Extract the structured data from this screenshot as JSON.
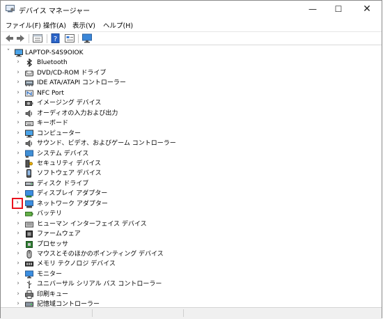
{
  "window": {
    "title": "デバイス マネージャー"
  },
  "menu": [
    {
      "label": "ファイル(F)"
    },
    {
      "label": "操作(A)"
    },
    {
      "label": "表示(V)"
    },
    {
      "label": "ヘルプ(H)"
    }
  ],
  "toolbar": [
    "back-icon",
    "forward-icon",
    "properties-icon",
    "help-icon",
    "device-view-icon",
    "monitor-scan-icon"
  ],
  "tree": {
    "root": {
      "label": "LAPTOP-S4S9OIOK",
      "icon": "computer-icon"
    },
    "items": [
      {
        "label": "Bluetooth",
        "icon": "bluetooth-icon"
      },
      {
        "label": "DVD/CD-ROM ドライブ",
        "icon": "dvd-drive-icon"
      },
      {
        "label": "IDE ATA/ATAPI コントローラー",
        "icon": "ide-controller-icon"
      },
      {
        "label": "NFC Port",
        "icon": "nfc-icon"
      },
      {
        "label": "イメージング デバイス",
        "icon": "camera-icon"
      },
      {
        "label": "オーディオの入力および出力",
        "icon": "speaker-icon"
      },
      {
        "label": "キーボード",
        "icon": "keyboard-icon"
      },
      {
        "label": "コンピューター",
        "icon": "computer-icon"
      },
      {
        "label": "サウンド、ビデオ、およびゲーム コントローラー",
        "icon": "speaker-icon"
      },
      {
        "label": "システム デバイス",
        "icon": "system-device-icon"
      },
      {
        "label": "セキュリティ デバイス",
        "icon": "security-key-icon"
      },
      {
        "label": "ソフトウェア デバイス",
        "icon": "software-device-icon"
      },
      {
        "label": "ディスク ドライブ",
        "icon": "disk-drive-icon"
      },
      {
        "label": "ディスプレイ アダプター",
        "icon": "display-adapter-icon"
      },
      {
        "label": "ネットワーク アダプター",
        "icon": "network-adapter-icon",
        "highlight": true
      },
      {
        "label": "バッテリ",
        "icon": "battery-icon"
      },
      {
        "label": "ヒューマン インターフェイス デバイス",
        "icon": "hid-icon"
      },
      {
        "label": "ファームウェア",
        "icon": "firmware-icon"
      },
      {
        "label": "プロセッサ",
        "icon": "processor-icon"
      },
      {
        "label": "マウスとそのほかのポインティング デバイス",
        "icon": "mouse-icon"
      },
      {
        "label": "メモリ テクノロジ デバイス",
        "icon": "memory-icon"
      },
      {
        "label": "モニター",
        "icon": "monitor-icon"
      },
      {
        "label": "ユニバーサル シリアル バス コントローラー",
        "icon": "usb-icon"
      },
      {
        "label": "印刷キュー",
        "icon": "printer-icon"
      },
      {
        "label": "記憶域コントローラー",
        "icon": "storage-controller-icon"
      }
    ]
  },
  "colors": {
    "highlight": "#e8131e",
    "accent": "#1e72c8"
  }
}
